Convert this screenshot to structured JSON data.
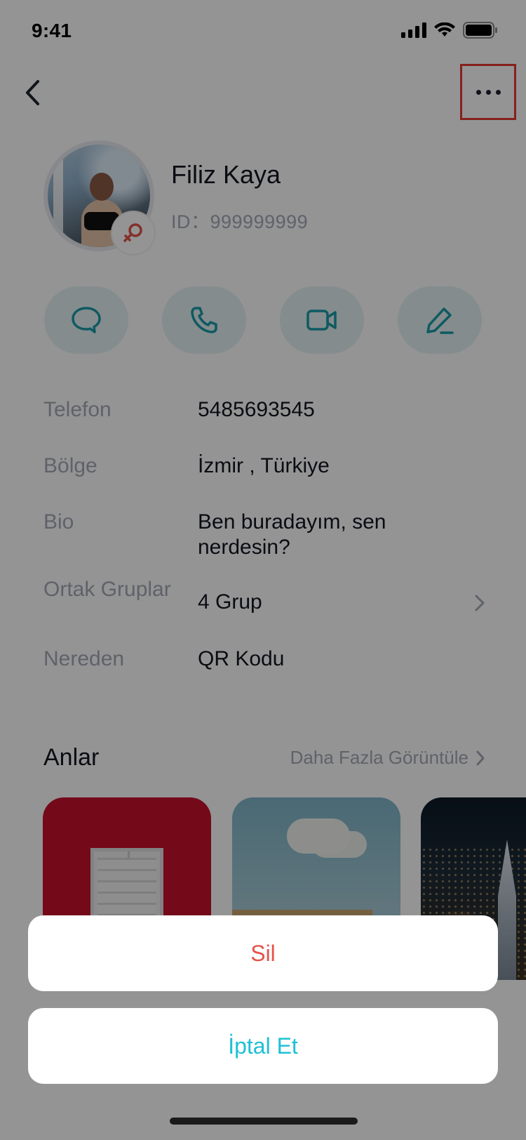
{
  "status_bar": {
    "time": "9:41"
  },
  "nav": {
    "back_icon": "chevron-left-icon",
    "more_icon": "more-horizontal-icon",
    "more_highlight_color": "#e53935"
  },
  "profile": {
    "name": "Filiz Kaya",
    "id_text": "ID：999999999",
    "gender_icon": "female-icon",
    "gender_color": "#e4534b"
  },
  "actions": [
    {
      "icon": "message-icon"
    },
    {
      "icon": "phone-icon"
    },
    {
      "icon": "video-icon"
    },
    {
      "icon": "edit-icon"
    }
  ],
  "info": {
    "phone": {
      "label": "Telefon",
      "value": "5485693545"
    },
    "region": {
      "label": "Bölge",
      "value": "İzmir , Türkiye"
    },
    "bio": {
      "label": "Bio",
      "value": "Ben buradayım, sen nerdesin?"
    },
    "groups": {
      "label": "Ortak Gruplar",
      "value": "4 Grup"
    },
    "source": {
      "label": "Nereden",
      "value": "QR Kodu"
    }
  },
  "moments": {
    "title": "Anlar",
    "more_label": "Daha Fazla Görüntüle"
  },
  "action_sheet": {
    "delete_label": "Sil",
    "cancel_label": "İptal Et",
    "delete_color": "#e4534b",
    "cancel_color": "#1ec0d6"
  },
  "colors": {
    "accent": "#1a9ba8",
    "action_bg": "#e3f1f3"
  }
}
